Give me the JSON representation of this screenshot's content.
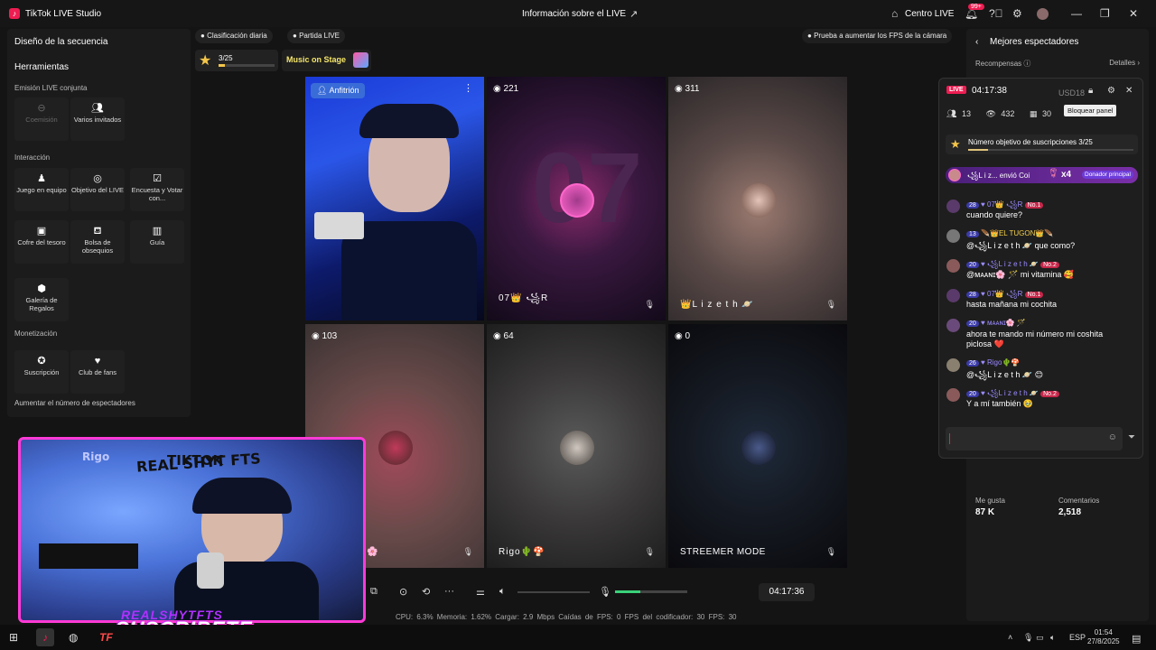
{
  "titlebar": {
    "app_title": "TikTok LIVE Studio",
    "live_info": "Información sobre el LIVE",
    "centro": "Centro LIVE",
    "notif_badge": "99+"
  },
  "left_panel": {
    "sequence_title": "Diseño de la secuencia",
    "tools_title": "Herramientas",
    "section_joint": "Emisión LIVE conjunta",
    "tool_coemision": "Coemisión",
    "tool_varios": "Varios invitados",
    "section_interaccion": "Interacción",
    "tool_juego": "Juego en equipo",
    "tool_objetivo": "Objetivo del LIVE",
    "tool_encuesta": "Encuesta y Votar con...",
    "tool_cofre": "Cofre del tesoro",
    "tool_bolsa": "Bolsa de obsequios",
    "tool_guia": "Guía",
    "tool_galeria": "Galería de Regalos",
    "section_monetizacion": "Monetización",
    "tool_suscripcion": "Suscripción",
    "tool_club": "Club de fans",
    "aumentar": "Aumentar el número de espectadores"
  },
  "top": {
    "clasificacion": "Clasificación diaria",
    "partida": "Partida LIVE",
    "hint": "Prueba a aumentar los FPS de la cámara",
    "stars": "3/25",
    "music": "Music on Stage"
  },
  "grid": {
    "host_badge": "Anfitrión",
    "cells": [
      {
        "count": "",
        "name": ""
      },
      {
        "count": "221",
        "name": "07👑 ꧁R"
      },
      {
        "count": "311",
        "name": "👑L i z e t h 🪐"
      },
      {
        "count": "103",
        "name": "s🌸"
      },
      {
        "count": "64",
        "name": "Rigo🌵🍄"
      },
      {
        "count": "0",
        "name": "STREEMER MODE"
      }
    ]
  },
  "controls": {
    "time": "04:17:36",
    "stats": "CPU: 6.3%   Memoria: 1.62%   Cargar: 2.9 Mbps   Caídas de FPS: 0   FPS del codificador: 30   FPS: 30",
    "mic_level": 0.35
  },
  "right_panel": {
    "title": "Mejores espectadores",
    "recompensas": "Recompensas",
    "detalles": "Detalles",
    "likes_label": "Me gusta",
    "likes": "87 K",
    "comments_label": "Comentarios",
    "comments": "2,518"
  },
  "chat": {
    "live": "LIVE",
    "time": "04:17:38",
    "usd": "USD18",
    "tooltip": "Bloquear panel",
    "viewers_a": "13",
    "viewers_b": "432",
    "gifts": "30",
    "goal_text": "Número objetivo de suscripciones 3/25",
    "goal_progress": 0.12,
    "gift_text": "꧁L i z...  envió Coi",
    "gift_count": "x4",
    "gift_tag": "Donador principal",
    "messages": [
      {
        "level": "28",
        "user": "07👑 ꧁R",
        "rank": "No.1",
        "text": "cuando quiere?"
      },
      {
        "level": "13",
        "user": "🪶👑EL TUGON👑🪶",
        "rank": "",
        "text": "@꧁L i z e t h 🪐 que como?"
      },
      {
        "level": "20",
        "user": "꧁L i z e t h 🪐",
        "rank": "No.2",
        "text": "@ᴍᴀᴀɴɪ🌸 🪄 mi vitamina 🥰"
      },
      {
        "level": "28",
        "user": "07👑 ꧁R",
        "rank": "No.1",
        "text": "hasta mañana mi cochita"
      },
      {
        "level": "20",
        "user": "ᴍᴀᴀɴɪ🌸 🪄",
        "rank": "",
        "text": "ahora te mando mi número mi coshita piclosa ❤️"
      },
      {
        "level": "26",
        "user": "Rigo🌵🍄",
        "rank": "",
        "text": "@꧁L i z e t h 🪐 😊"
      },
      {
        "level": "20",
        "user": "꧁L i z e t h 🪐",
        "rank": "No.2",
        "text": "Y a mí también 🥹"
      }
    ]
  },
  "overlay": {
    "realshyt": "REALSHYTFTS",
    "suscribete": "SUSCRIBETE",
    "wall_tiktok": "TIKTOK",
    "wall_rigo": "Rigo",
    "wall_real": "REAL SHYT FTS"
  },
  "taskbar": {
    "lang": "ESP",
    "time": "01:54",
    "date": "27/8/2025"
  }
}
